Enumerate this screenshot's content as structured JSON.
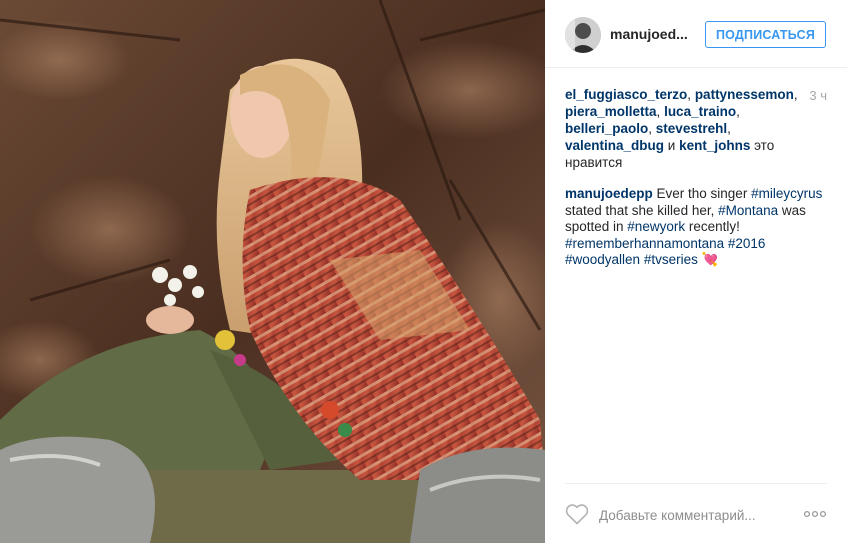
{
  "photo": {
    "alt_icon": "post-photo"
  },
  "header": {
    "username": "manujoed...",
    "follow_label": "ПОДПИСАТЬСЯ"
  },
  "likes": {
    "users": [
      "el_fuggiasco_terzo",
      "pattynessemon",
      "piera_molletta",
      "luca_traino",
      "belleri_paolo",
      "stevestrehl",
      "valentina_dbug",
      "kent_johns"
    ],
    "sep1": ", ",
    "conj": " и ",
    "suffix": " это нравится",
    "time": "3 ч"
  },
  "caption": {
    "user": "manujoedepp",
    "text1": " Ever tho singer ",
    "tag1": "#mileycyrus",
    "text2": " stated that she killed her, ",
    "tag2": "#Montana",
    "text3": " was spotted in ",
    "tag3": "#newyork",
    "text4": " recently! ",
    "tag4": "#rememberhannamontana",
    "space": " ",
    "tag5": "#2016",
    "tag6": "#woodyallen",
    "tag7": "#tvseries",
    "emoji": " 💘"
  },
  "footer": {
    "comment_placeholder": "Добавьте комментарий...",
    "icons": [
      "heart-icon",
      "more-options-icon"
    ]
  },
  "colors": {
    "link": "#003569",
    "follow": "#3897f0",
    "divider": "#efefef",
    "muted": "#a5a7aa"
  }
}
